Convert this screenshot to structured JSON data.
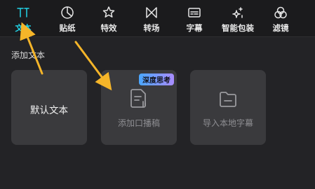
{
  "toolbar": {
    "items": [
      {
        "label": "文本",
        "icon": "text-icon",
        "active": true
      },
      {
        "label": "贴纸",
        "icon": "sticker-icon"
      },
      {
        "label": "特效",
        "icon": "effects-icon"
      },
      {
        "label": "转场",
        "icon": "transition-icon"
      },
      {
        "label": "字幕",
        "icon": "subtitle-icon"
      },
      {
        "label": "智能包装",
        "icon": "smart-package-icon"
      },
      {
        "label": "滤镜",
        "icon": "filter-icon"
      }
    ],
    "accent_color": "#22d3e6"
  },
  "section": {
    "title": "添加文本"
  },
  "cards": [
    {
      "label": "默认文本"
    },
    {
      "label": "添加口播稿",
      "badge": "深度思考",
      "icon": "script-doc-icon"
    },
    {
      "label": "导入本地字幕",
      "icon": "folder-icon"
    }
  ],
  "annotations": {
    "arrow_color": "#f5b529"
  }
}
